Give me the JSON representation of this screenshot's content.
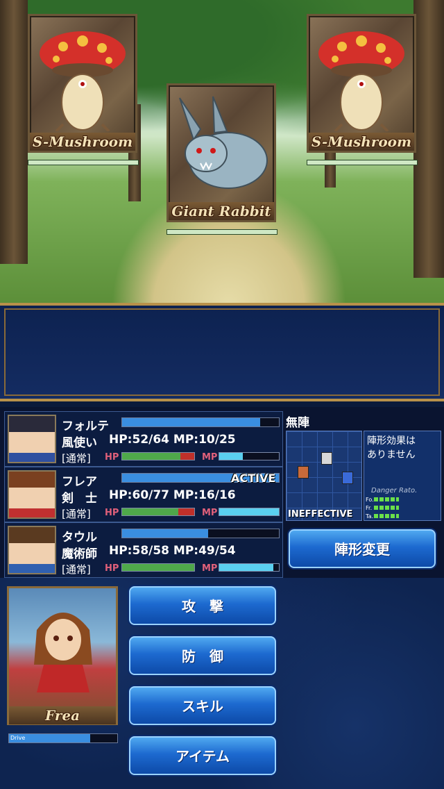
{
  "enemies": [
    {
      "name": "S-Mushroom",
      "hp_fraction": 1.0
    },
    {
      "name": "Giant Rabbit",
      "hp_fraction": 1.0
    },
    {
      "name": "S-Mushroom",
      "hp_fraction": 1.0
    }
  ],
  "party": [
    {
      "name": "フォルテ",
      "job": "風使い",
      "stats": "HP:52/64 MP:10/25",
      "status": "[通常]",
      "hp_label": "HP",
      "mp_label": "MP",
      "hp_fraction": 0.81,
      "mp_fraction": 0.4,
      "atb_fraction": 0.88,
      "active_text": ""
    },
    {
      "name": "フレア",
      "job": "剣　士",
      "stats": "HP:60/77 MP:16/16",
      "status": "[通常]",
      "hp_label": "HP",
      "mp_label": "MP",
      "hp_fraction": 0.78,
      "mp_fraction": 1.0,
      "atb_fraction": 1.0,
      "active_text": "ACTIVE"
    },
    {
      "name": "タウル",
      "job": "魔術師",
      "stats": "HP:58/58 MP:49/54",
      "status": "[通常]",
      "hp_label": "HP",
      "mp_label": "MP",
      "hp_fraction": 1.0,
      "mp_fraction": 0.91,
      "atb_fraction": 0.55,
      "active_text": ""
    }
  ],
  "formation": {
    "title": "無陣",
    "effect_text": "陣形効果は\nありません",
    "danger_label": "Danger Rato.",
    "danger_rows": [
      "Fo.",
      "Fr.",
      "Ta."
    ],
    "status_text": "INEFFECTIVE",
    "change_button": "陣形変更"
  },
  "commands": {
    "attack": "攻　撃",
    "defend": "防　御",
    "skill": "スキル",
    "item": "アイテム"
  },
  "active_character": {
    "name": "Frea",
    "drive_label": "Drive",
    "drive_fraction": 0.75
  },
  "colors": {
    "hp_green": "#4fa84a",
    "hp_red": "#c0302a",
    "mp_cyan": "#5ad0f0",
    "atb_blue": "#3a8ee0"
  }
}
